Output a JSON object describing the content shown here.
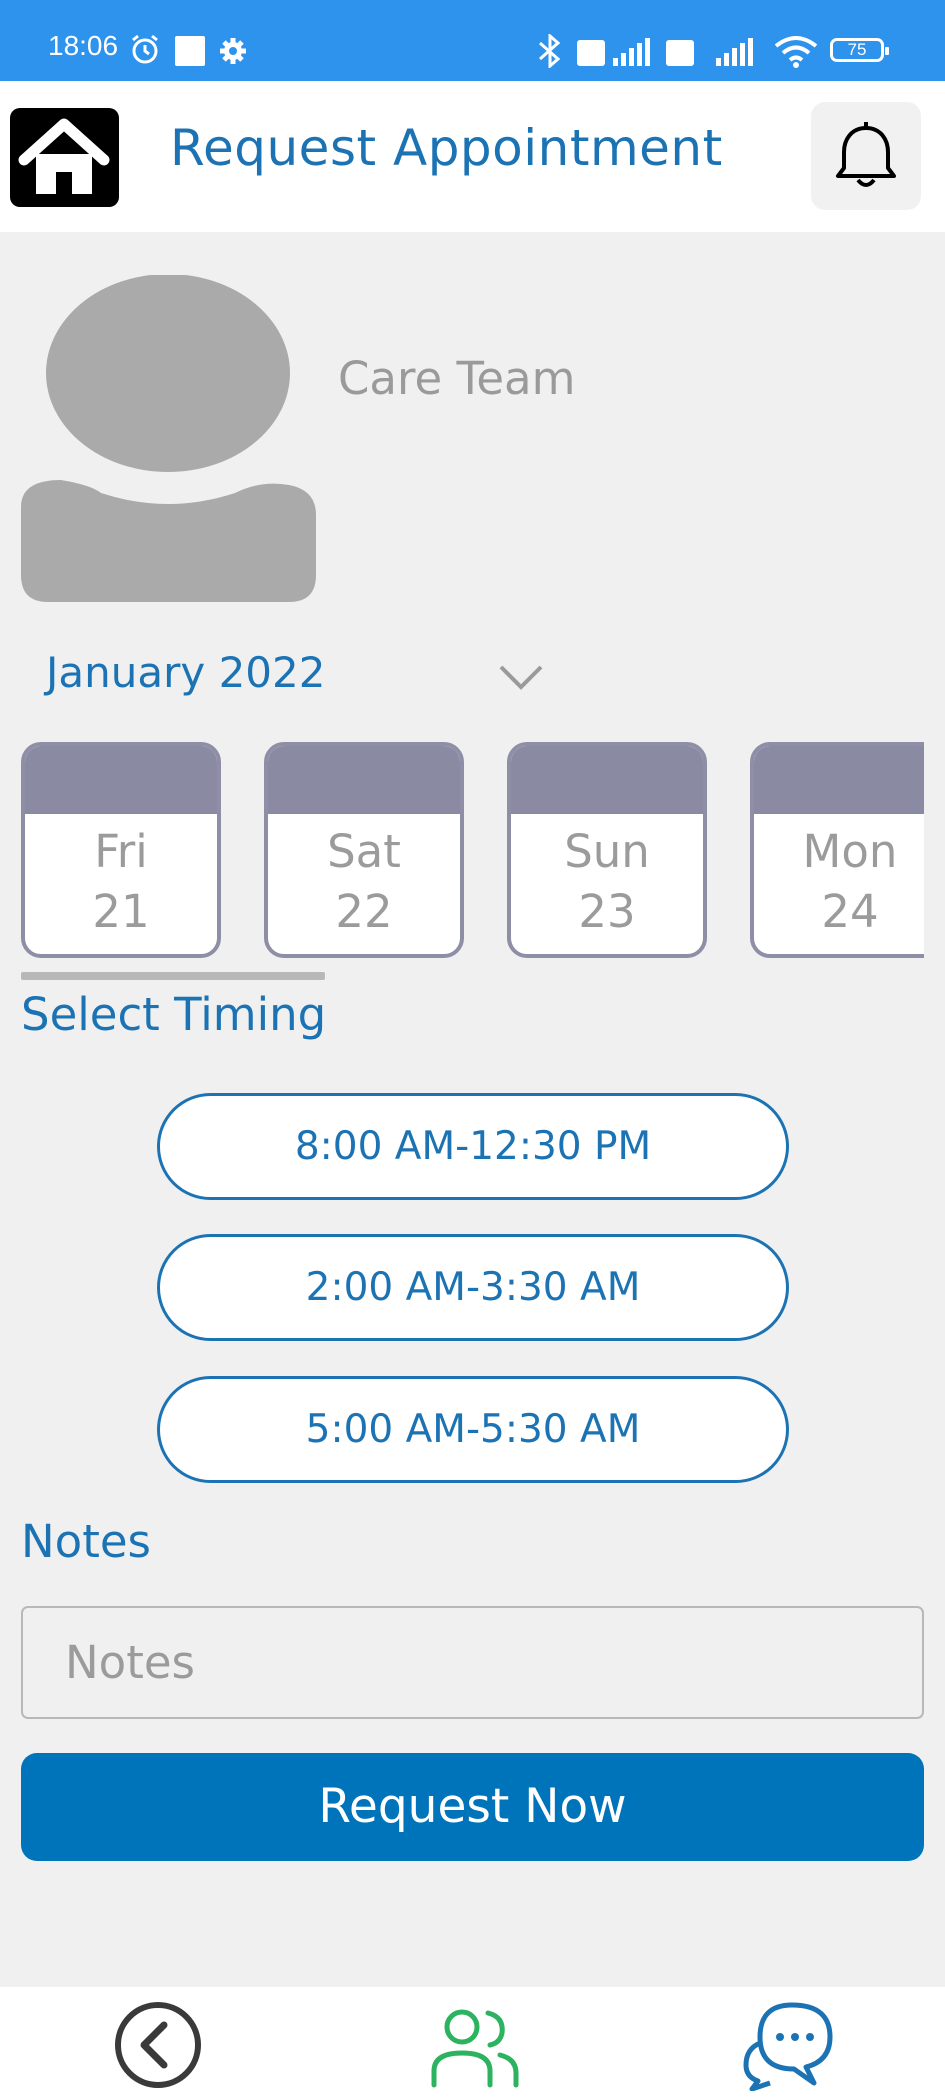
{
  "status_bar": {
    "time": "18:06",
    "battery": "75",
    "icons": [
      "alarm-icon",
      "square-icon",
      "gear-icon",
      "bluetooth-icon",
      "volte-icon",
      "signal-icon",
      "volte-icon",
      "4g-signal-icon",
      "wifi-icon",
      "battery-icon"
    ]
  },
  "header": {
    "title": "Request Appointment",
    "home_icon": "home-icon",
    "bell_icon": "bell-icon"
  },
  "profile": {
    "name": "Care Team"
  },
  "calendar": {
    "month": "January 2022",
    "days": [
      {
        "day": "Fri",
        "date": "21"
      },
      {
        "day": "Sat",
        "date": "22"
      },
      {
        "day": "Sun",
        "date": "23"
      },
      {
        "day": "Mon",
        "date": "24"
      }
    ]
  },
  "timing": {
    "heading": "Select Timing",
    "slots": [
      "8:00 AM-12:30 PM",
      "2:00 AM-3:30 AM",
      "5:00 AM-5:30 AM"
    ]
  },
  "notes": {
    "heading": "Notes",
    "placeholder": "Notes"
  },
  "request_button": "Request Now",
  "bottom_nav": {
    "items": [
      "back-icon",
      "people-icon",
      "chat-icon"
    ],
    "active_color": "#2bb35f",
    "accent_color": "#1c73b4"
  },
  "colors": {
    "primary": "#1c73b4",
    "button": "#0074ba",
    "status_bar": "#2d93ec",
    "card_header": "#8a8aa3"
  }
}
